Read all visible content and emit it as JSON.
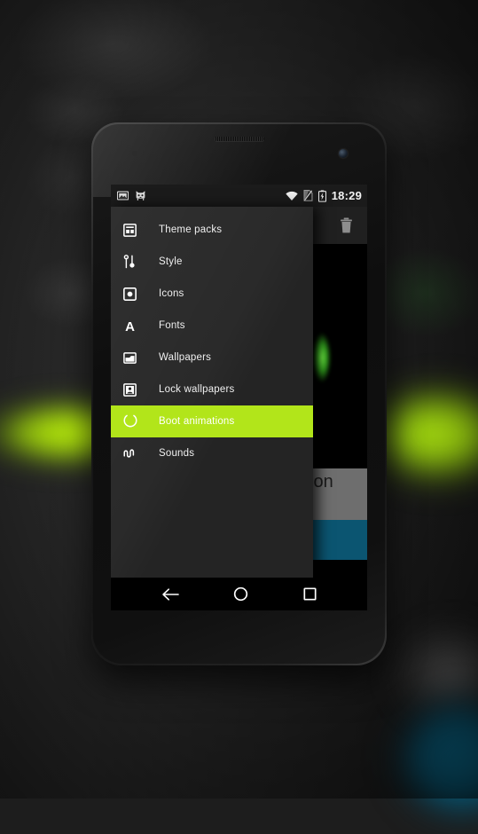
{
  "background": {
    "accent_green": "#b2e51a",
    "accent_teal": "#0b5571",
    "description_alt": "blurred theme chooser screen"
  },
  "phone": {
    "device_style": "nexus-4",
    "statusbar": {
      "notification_icons": [
        "screenshot-icon",
        "cat-face-icon"
      ],
      "system_icons": [
        "wifi-icon",
        "no-sim-icon",
        "battery-charging-icon"
      ],
      "clock": "18:29"
    },
    "actionbar": {
      "delete_label": "",
      "icons": [
        "trash-icon"
      ]
    },
    "content": {
      "card_text": "ion",
      "teal_block_color": "#0b5571",
      "grey_block_color": "#6e6e6e"
    },
    "navbar": {
      "items": [
        {
          "name": "back",
          "icon": "back-arrow-icon"
        },
        {
          "name": "home",
          "icon": "home-circle-icon"
        },
        {
          "name": "recents",
          "icon": "recents-square-icon"
        }
      ]
    },
    "drawer": {
      "selected_index": 6,
      "highlight_color": "#b2e51a",
      "items": [
        {
          "label": "Theme packs",
          "icon": "theme-packs-icon"
        },
        {
          "label": "Style",
          "icon": "style-sliders-icon"
        },
        {
          "label": "Icons",
          "icon": "icons-dot-icon"
        },
        {
          "label": "Fonts",
          "icon": "fonts-letter-a-icon"
        },
        {
          "label": "Wallpapers",
          "icon": "wallpapers-image-icon"
        },
        {
          "label": "Lock wallpapers",
          "icon": "lock-wallpapers-icon"
        },
        {
          "label": "Boot animations",
          "icon": "boot-animations-spinner-icon"
        },
        {
          "label": "Sounds",
          "icon": "sounds-wave-icon"
        }
      ]
    }
  }
}
